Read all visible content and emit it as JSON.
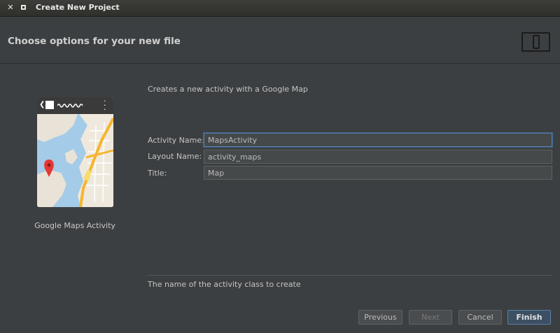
{
  "window": {
    "title": "Create New Project",
    "close_glyph": "✕"
  },
  "header": {
    "title": "Choose options for your new file",
    "icon": "device-icon"
  },
  "template": {
    "caption": "Google Maps Activity",
    "description": "Creates a new activity with a Google Map"
  },
  "form": {
    "activity_name": {
      "label": "Activity Name:",
      "value": "MapsActivity"
    },
    "layout_name": {
      "label": "Layout Name:",
      "value": "activity_maps"
    },
    "title": {
      "label": "Title:",
      "value": "Map"
    }
  },
  "help_text": "The name of the activity class to create",
  "buttons": {
    "previous": "Previous",
    "next": "Next",
    "cancel": "Cancel",
    "finish": "Finish"
  },
  "colors": {
    "background": "#3c3f41",
    "focus": "#5a7fa8",
    "map_marker": "#e53935",
    "map_road": "#f5b52e"
  }
}
